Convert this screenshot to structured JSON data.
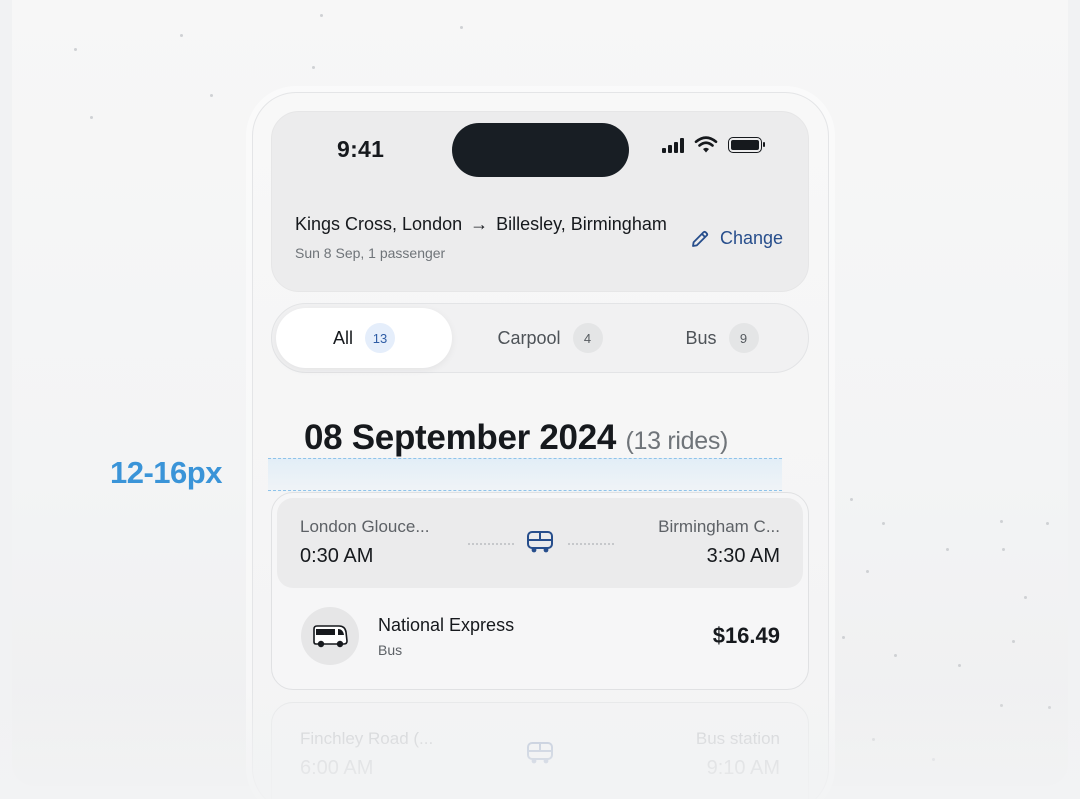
{
  "status_bar": {
    "time": "9:41"
  },
  "trip": {
    "from": "Kings Cross, London",
    "to": "Billesley, Birmingham",
    "details": "Sun 8 Sep, 1 passenger",
    "change_label": "Change"
  },
  "tabs": [
    {
      "label": "All",
      "count": "13",
      "active": true
    },
    {
      "label": "Carpool",
      "count": "4",
      "active": false
    },
    {
      "label": "Bus",
      "count": "9",
      "active": false
    }
  ],
  "results": {
    "date": "08 September 2024",
    "count_label": "(13 rides)"
  },
  "annotation": {
    "label": "12-16px",
    "color": "#3a94d8"
  },
  "rides": [
    {
      "from_name": "London Glouce...",
      "from_time": "0:30 AM",
      "to_name": "Birmingham C...",
      "to_time": "3:30 AM",
      "operator": "National Express",
      "type": "Bus",
      "price": "$16.49",
      "icon": "bus-icon"
    },
    {
      "from_name": "Finchley Road (...",
      "from_time": "6:00 AM",
      "to_name": "Bus station",
      "to_time": "9:10 AM",
      "icon": "bus-icon"
    }
  ],
  "colors": {
    "accent": "#274e8c",
    "text": "#16191d",
    "muted": "#6f7479"
  }
}
